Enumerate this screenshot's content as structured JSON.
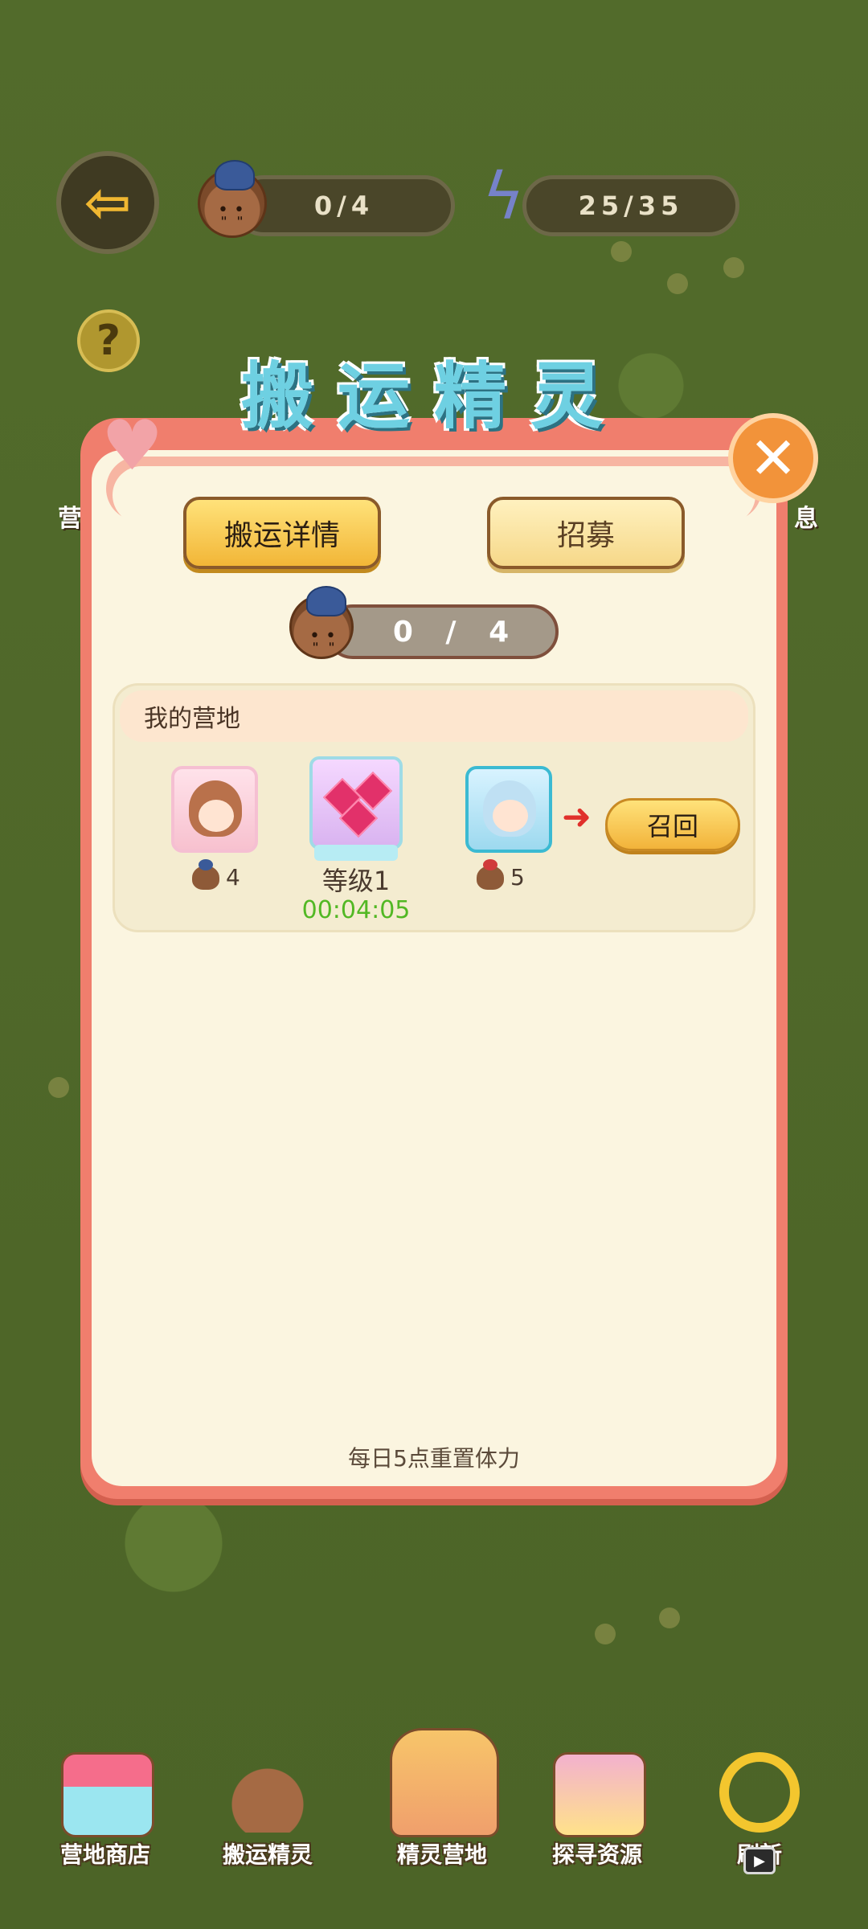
{
  "hud": {
    "workers": "0/4",
    "energy": "25/35"
  },
  "dialog": {
    "title": "搬运精灵",
    "tabs": [
      {
        "label": "搬运详情",
        "active": true
      },
      {
        "label": "招募",
        "active": false
      }
    ],
    "worker_count": "0 / 4",
    "camp": {
      "header": "我的营地",
      "left_worker_count": "4",
      "level": "等级1",
      "timer": "00:04:05",
      "right_worker_count": "5",
      "recall_label": "召回"
    },
    "reset_note": "每日5点重置体力"
  },
  "side_labels": {
    "left": "营",
    "right": "息"
  },
  "bottom_nav": [
    {
      "label": "营地商店",
      "icon": "shop-icon"
    },
    {
      "label": "搬运精灵",
      "icon": "carrier-sprite-icon"
    },
    {
      "label": "精灵营地",
      "icon": "sprite-camp-icon"
    },
    {
      "label": "探寻资源",
      "icon": "explore-resources-icon"
    },
    {
      "label": "刷新",
      "icon": "refresh-icon"
    }
  ],
  "colors": {
    "background": "#526b2b",
    "dialog_border": "#f07e6d",
    "dialog_fill": "#fbf5e0",
    "title": "#6ed0e2",
    "timer": "#52b824"
  }
}
